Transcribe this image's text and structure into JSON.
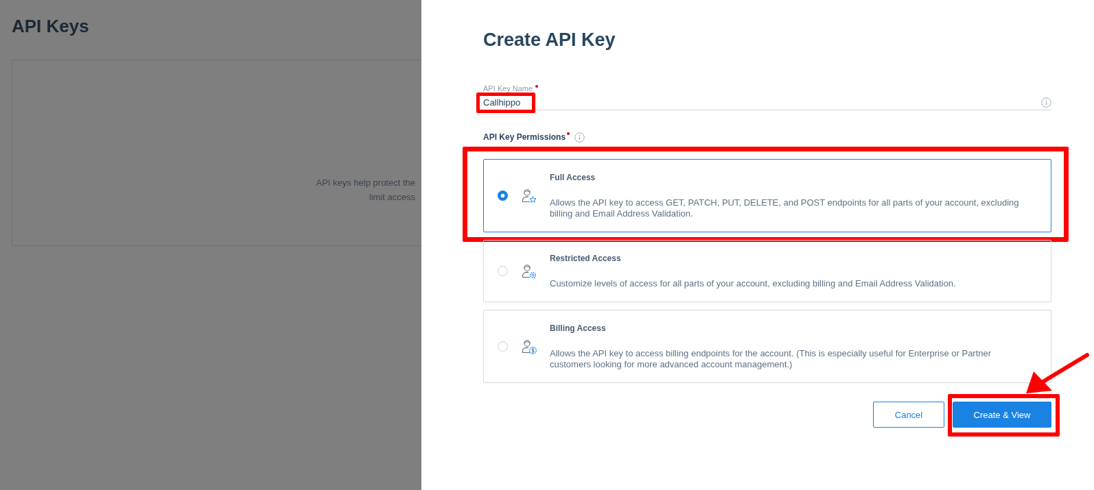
{
  "background_page": {
    "title": "API Keys",
    "empty_state_lines": [
      "API keys help protect the",
      "limit access"
    ]
  },
  "drawer": {
    "title": "Create API Key",
    "name_field": {
      "label": "API Key Name",
      "required": true,
      "value": "Callhippo",
      "highlighted": true
    },
    "permissions": {
      "label": "API Key Permissions",
      "required": true,
      "options": [
        {
          "title": "Full Access",
          "description": "Allows the API key to access GET, PATCH, PUT, DELETE, and POST endpoints for all parts of your account, excluding billing and Email Address Validation.",
          "selected": true,
          "highlighted": true
        },
        {
          "title": "Restricted Access",
          "description": "Customize levels of access for all parts of your account, excluding billing and Email Address Validation.",
          "selected": false,
          "highlighted": false
        },
        {
          "title": "Billing Access",
          "description": "Allows the API key to access billing endpoints for the account. (This is especially useful for Enterprise or Partner customers looking for more advanced account management.)",
          "selected": false,
          "highlighted": false
        }
      ]
    },
    "buttons": [
      {
        "label": "Cancel",
        "kind": "secondary",
        "highlighted": false,
        "arrow": false
      },
      {
        "label": "Create & View",
        "kind": "primary",
        "highlighted": true,
        "arrow": true
      }
    ]
  }
}
